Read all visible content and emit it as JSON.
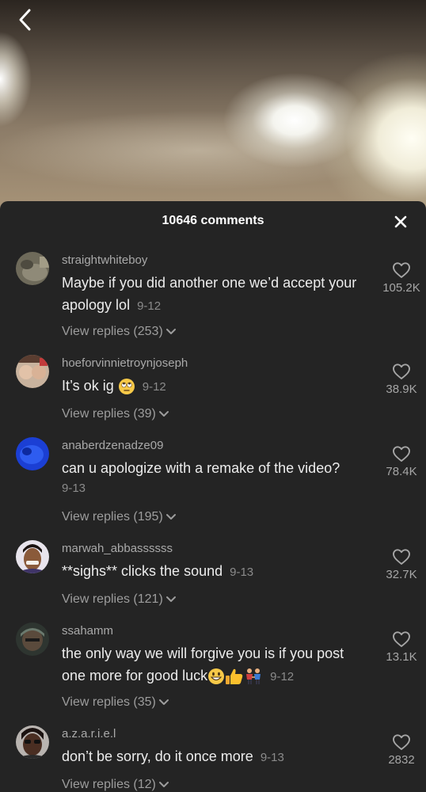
{
  "header": {
    "comment_count_label": "10646 comments"
  },
  "comments": [
    {
      "username": "straightwhiteboy",
      "text": "Maybe if you did another one we’d accept your apology lol",
      "date": "9-12",
      "likes": "105.2K",
      "replies_label": "View replies (253)"
    },
    {
      "username": "hoeforvinnietroynjoseph",
      "text": "It’s ok ig",
      "emojis": [
        "face-with-rolling-eyes"
      ],
      "date": "9-12",
      "likes": "38.9K",
      "replies_label": "View replies (39)"
    },
    {
      "username": "anaberdzenadze09",
      "text": "can u apologize with a remake of the video?",
      "date": "9-13",
      "likes": "78.4K",
      "replies_label": "View replies (195)"
    },
    {
      "username": "marwah_abbassssss",
      "text": "**sighs** clicks the sound",
      "date": "9-13",
      "likes": "32.7K",
      "replies_label": "View replies (121)"
    },
    {
      "username": "ssahamm",
      "text": "the only way we will forgive you is if you post one more for good luck",
      "emojis": [
        "grinning-face",
        "thumbs-up",
        "couple-holding-hands"
      ],
      "date": "9-12",
      "likes": "13.1K",
      "replies_label": "View replies (35)"
    },
    {
      "username": "a.z.a.r.i.e.l",
      "text": "don’t be sorry, do it once more",
      "date": "9-13",
      "likes": "2832",
      "replies_label": "View replies (12)"
    }
  ],
  "icons": [
    "back-arrow-icon",
    "close-icon",
    "heart-outline-icon",
    "chevron-down-icon"
  ],
  "colors": {
    "sheet_bg": "#242424",
    "username": "#a9a9a9",
    "date": "#8b8b8b"
  }
}
